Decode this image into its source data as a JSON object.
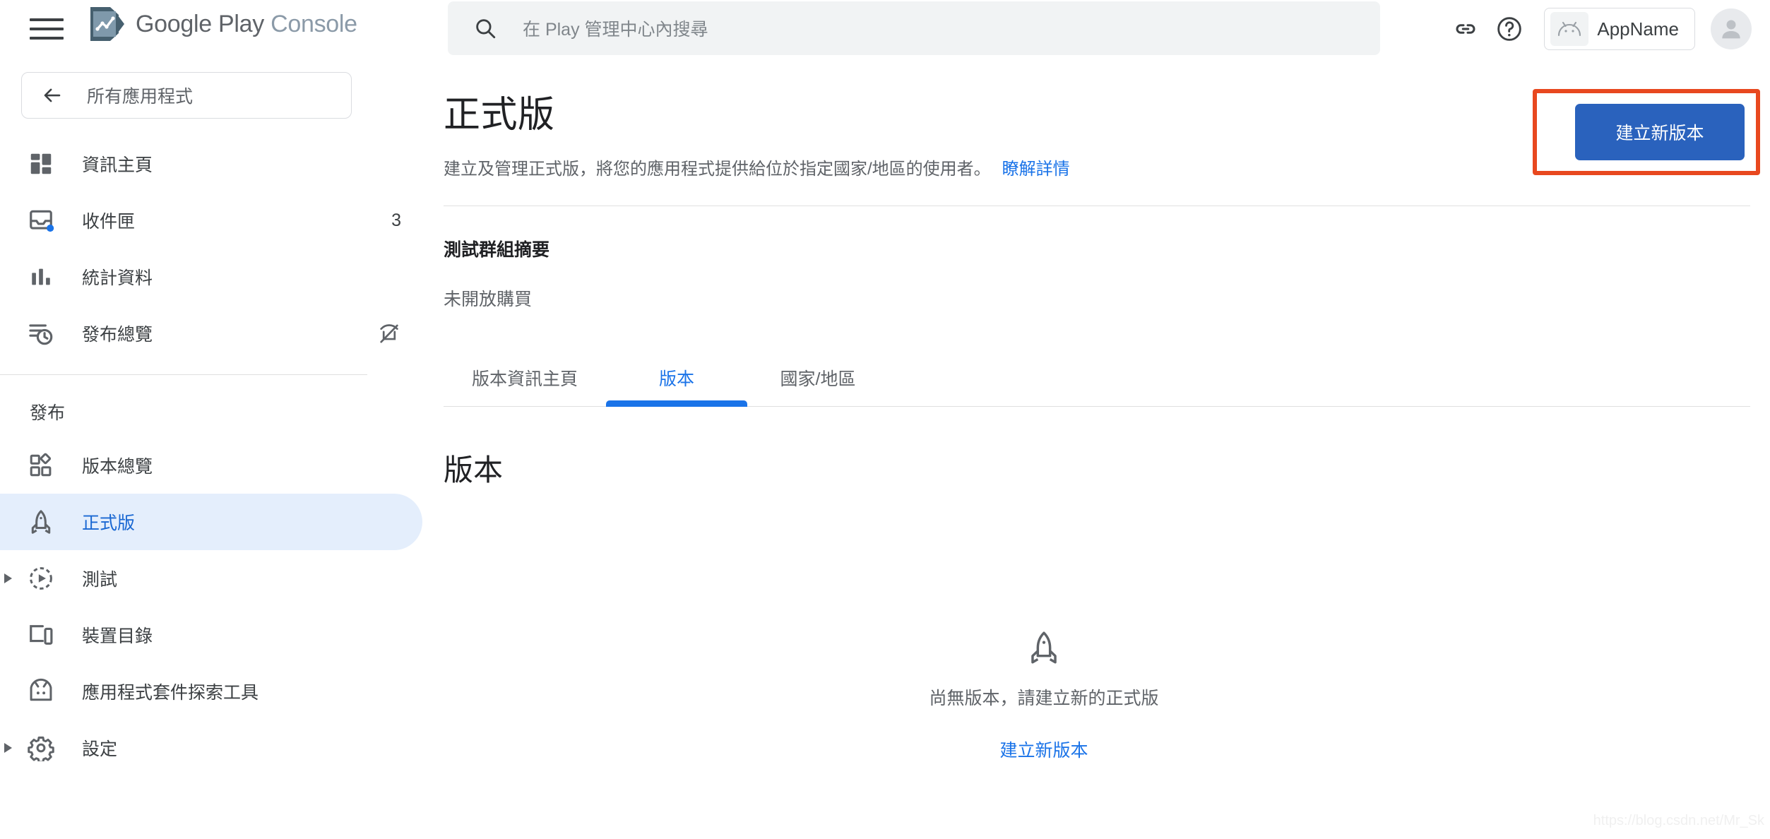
{
  "topbar": {
    "menu_icon": "hamburger-menu-icon",
    "brand": {
      "part1": "Google Play",
      "part2": "Console",
      "logo_icon": "google-play-console-logo"
    },
    "search": {
      "placeholder": "在 Play 管理中心內搜尋",
      "icon": "search-icon"
    },
    "link_icon": "link-icon",
    "help_icon": "help-circle-icon",
    "app_chip": {
      "label": "AppName",
      "icon": "android-head-icon"
    },
    "avatar_icon": "user-avatar-icon"
  },
  "sidebar": {
    "back": {
      "label": "所有應用程式",
      "icon": "arrow-back-icon"
    },
    "items": [
      {
        "label": "資訊主頁",
        "icon": "dashboard-icon",
        "badge": "",
        "active": false,
        "caret": false
      },
      {
        "label": "收件匣",
        "icon": "inbox-icon",
        "badge": "3",
        "active": false,
        "caret": false
      },
      {
        "label": "統計資料",
        "icon": "bar-chart-icon",
        "badge": "",
        "active": false,
        "caret": false
      },
      {
        "label": "發布總覽",
        "icon": "publishing-overview-icon",
        "badge": "",
        "active": false,
        "caret": false,
        "trailing_icon": "visibility-off-icon"
      }
    ],
    "section_title": "發布",
    "publish_items": [
      {
        "label": "版本總覽",
        "icon": "releases-overview-icon",
        "active": false,
        "caret": false
      },
      {
        "label": "正式版",
        "icon": "rocket-icon",
        "active": true,
        "caret": false
      },
      {
        "label": "測試",
        "icon": "testing-icon",
        "active": false,
        "caret": true
      },
      {
        "label": "裝置目錄",
        "icon": "device-catalog-icon",
        "active": false,
        "caret": false
      },
      {
        "label": "應用程式套件探索工具",
        "icon": "app-bundle-explorer-icon",
        "active": false,
        "caret": false
      },
      {
        "label": "設定",
        "icon": "gear-icon",
        "active": false,
        "caret": true
      }
    ]
  },
  "main": {
    "page_title": "正式版",
    "page_description": "建立及管理正式版，將您的應用程式提供給位於指定國家/地區的使用者。",
    "learn_more": "瞭解詳情",
    "create_release_button": "建立新版本",
    "summary_title": "測試群組摘要",
    "summary_status": "未開放購買",
    "tabs": [
      {
        "label": "版本資訊主頁",
        "active": false
      },
      {
        "label": "版本",
        "active": true
      },
      {
        "label": "國家/地區",
        "active": false
      }
    ],
    "section_title": "版本",
    "empty_state": {
      "icon": "rocket-icon",
      "text": "尚無版本，請建立新的正式版",
      "link": "建立新版本"
    }
  },
  "annotation": {
    "color": "#e8481f",
    "target": "create-release-button"
  },
  "watermark": "https://blog.csdn.net/Mr_Sk",
  "colors": {
    "accent_blue": "#1a73e8",
    "button_blue": "#2a62bd",
    "active_nav_bg": "#e4eefc",
    "text_primary": "#202124",
    "text_secondary": "#5f6368",
    "annotation_orange": "#e8481f"
  }
}
